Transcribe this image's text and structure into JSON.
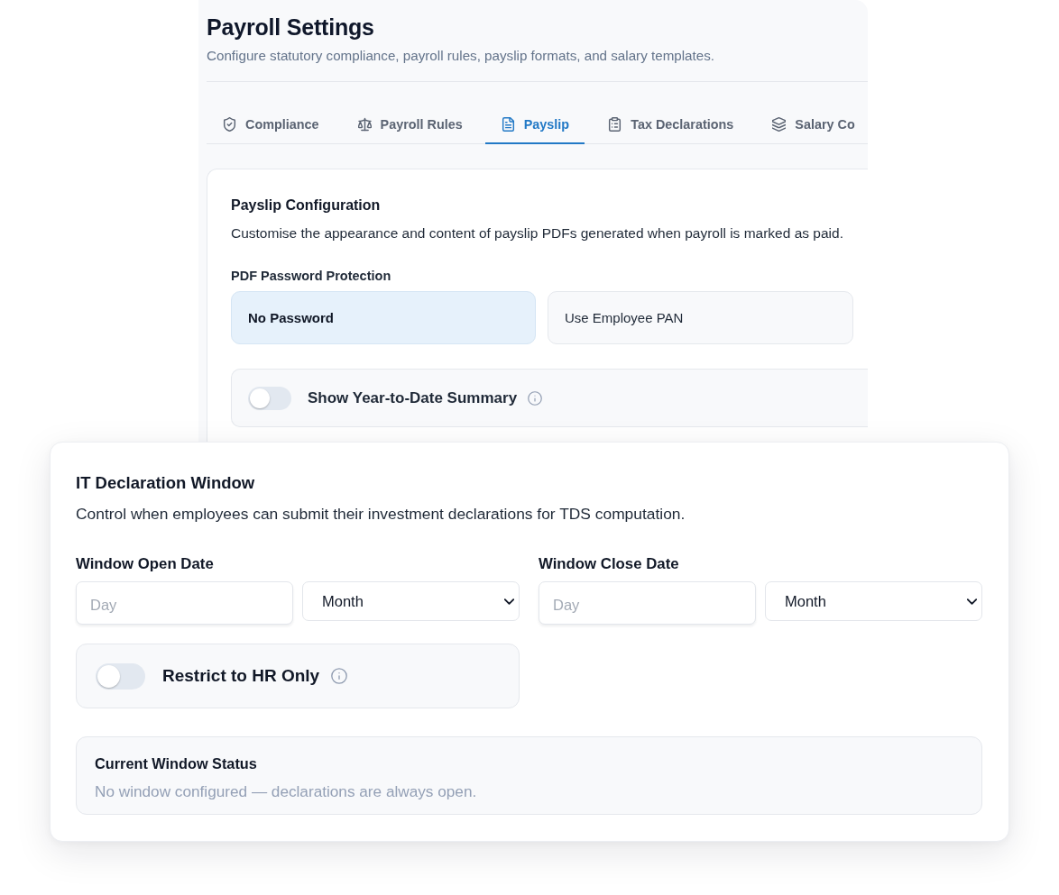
{
  "payroll_settings": {
    "title": "Payroll Settings",
    "subtitle": "Configure statutory compliance, payroll rules, payslip formats, and salary templates.",
    "tabs": [
      {
        "label": "Compliance",
        "selected": false
      },
      {
        "label": "Payroll Rules",
        "selected": false
      },
      {
        "label": "Payslip",
        "selected": true
      },
      {
        "label": "Tax Declarations",
        "selected": false
      },
      {
        "label": "Salary Co",
        "selected": false
      }
    ],
    "payslip_configuration": {
      "title": "Payslip Configuration",
      "description": "Customise the appearance and content of payslip PDFs generated when payroll is marked as paid.",
      "password_protection": {
        "label": "PDF Password Protection",
        "options": [
          {
            "label": "No Password",
            "selected": true
          },
          {
            "label": "Use Employee PAN",
            "selected": false
          }
        ]
      },
      "ytd_summary": {
        "label": "Show Year-to-Date Summary",
        "on": false
      }
    }
  },
  "it_declaration_window": {
    "title": "IT Declaration Window",
    "description": "Control when employees can submit their investment declarations for TDS computation.",
    "dates": [
      {
        "label": "Window Open Date",
        "day": {
          "placeholder": "Day"
        },
        "month": {
          "value": "Month"
        }
      },
      {
        "label": "Window Close Date",
        "day": {
          "placeholder": "Day"
        },
        "month": {
          "value": "Month"
        }
      }
    ],
    "restrict_to_hr": {
      "label": "Restrict to HR Only",
      "on": false
    },
    "status": {
      "title": "Current Window Status",
      "message": "No window configured — declarations are always open."
    }
  }
}
